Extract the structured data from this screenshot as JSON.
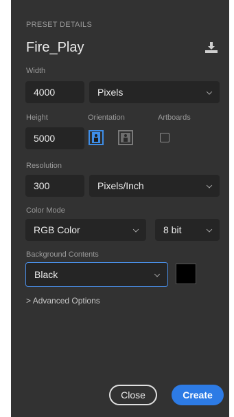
{
  "panel": {
    "section_title": "PRESET DETAILS",
    "preset_name": "Fire_Play",
    "save_icon": "download-save-icon"
  },
  "width": {
    "label": "Width",
    "value": "4000",
    "unit": "Pixels"
  },
  "height": {
    "label": "Height",
    "value": "5000"
  },
  "orientation": {
    "label": "Orientation",
    "selected": "portrait",
    "portrait_icon": "portrait-icon",
    "landscape_icon": "landscape-icon"
  },
  "artboards": {
    "label": "Artboards",
    "checked": false
  },
  "resolution": {
    "label": "Resolution",
    "value": "300",
    "unit": "Pixels/Inch"
  },
  "color_mode": {
    "label": "Color Mode",
    "mode": "RGB Color",
    "depth": "8 bit"
  },
  "background": {
    "label": "Background Contents",
    "value": "Black",
    "swatch_color": "#000000"
  },
  "advanced": {
    "label": "Advanced Options",
    "icon": "chevron-right-icon"
  },
  "buttons": {
    "close": "Close",
    "create": "Create"
  },
  "colors": {
    "accent": "#2d7be5",
    "panel_bg": "#323232",
    "field_bg": "#252525"
  }
}
